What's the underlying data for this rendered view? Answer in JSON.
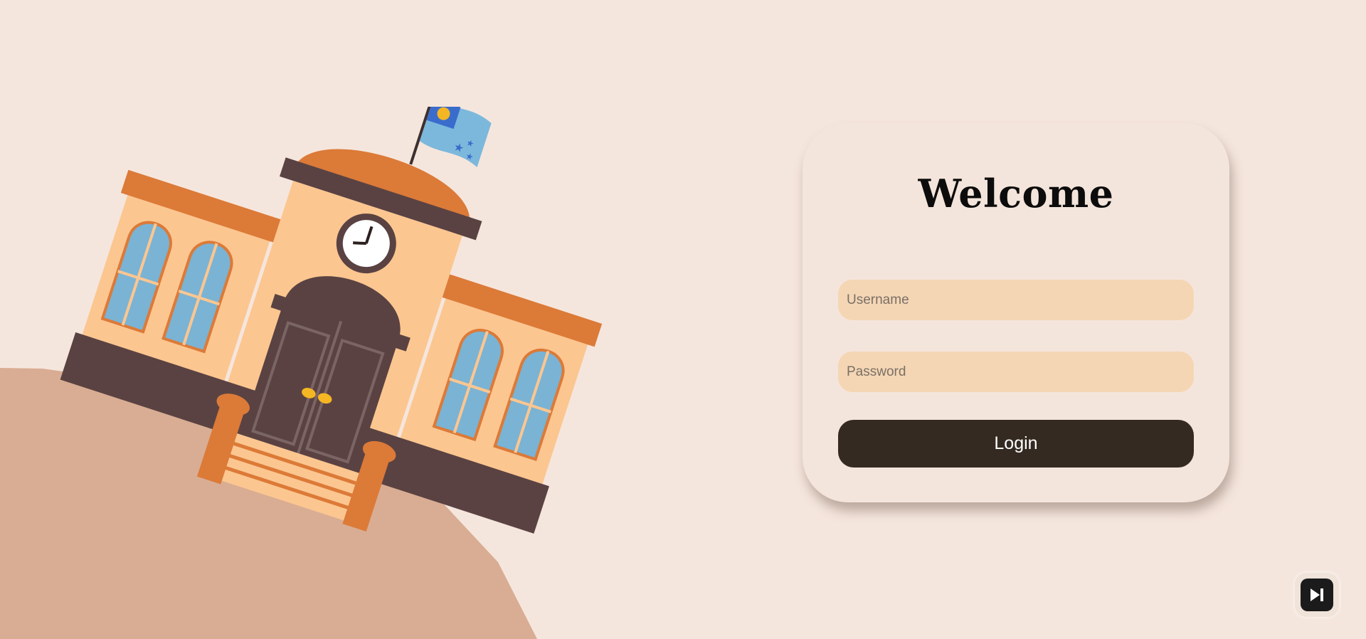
{
  "login": {
    "title": "Welcome",
    "username_placeholder": "Username",
    "password_placeholder": "Password",
    "login_label": "Login"
  },
  "icons": {
    "skip": "skip-forward-icon",
    "illustration": "school-building-illustration"
  },
  "colors": {
    "background": "#f5e6dd",
    "card": "#f4e5dc",
    "input": "#f5d6b4",
    "button": "#342a21",
    "hill": "#d9ad93"
  }
}
